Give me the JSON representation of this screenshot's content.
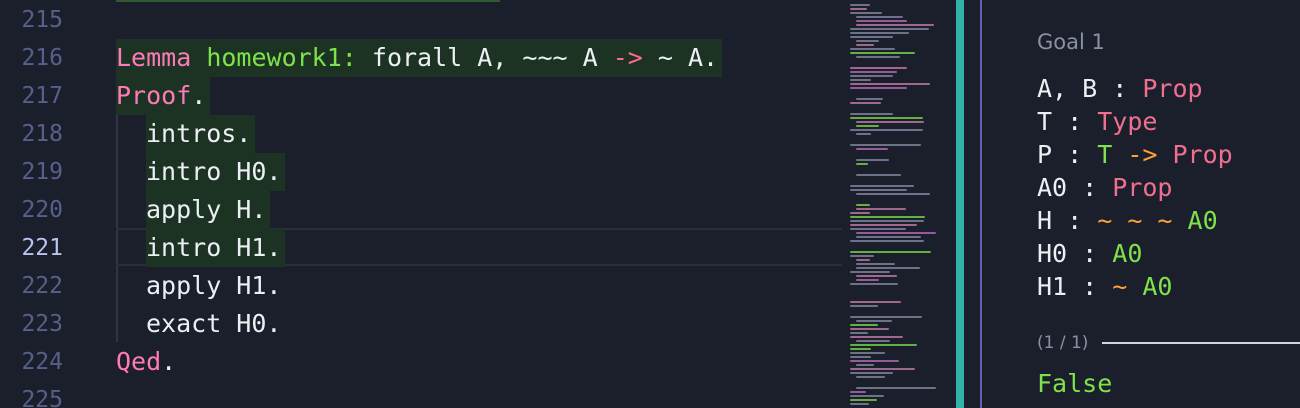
{
  "colors": {
    "background": "#1b1e2b",
    "keyword_pink": "#ff7ab7",
    "identifier_green": "#7ee24a",
    "arrow": "#ff6b8a",
    "highlight_bg": "#1c3324",
    "scrollbar_accent": "#2fb5a6",
    "panel_border": "#6d57b7",
    "tilde_orange": "#ffa13b",
    "type_pink": "#ee6f8e"
  },
  "editor": {
    "line_numbers": [
      "215",
      "216",
      "217",
      "218",
      "219",
      "220",
      "221",
      "222",
      "223",
      "224",
      "225"
    ],
    "active_line": "221",
    "lines": {
      "l216": {
        "kw": "Lemma",
        "name": "homework1:",
        "rest1": " forall A, ~~~ A ",
        "arrow": "->",
        "rest2": " ~ A."
      },
      "l217": {
        "kw": "Proof",
        "dot": "."
      },
      "l218": "intros.",
      "l219": "intro H0.",
      "l220": "apply H.",
      "l221": "intro H1.",
      "l222": "apply H1.",
      "l223": "exact H0.",
      "l224": {
        "kw": "Qed",
        "dot": "."
      }
    }
  },
  "goal_panel": {
    "title": "Goal 1",
    "hypotheses": {
      "ab": {
        "names": "A, B",
        "colon": " : ",
        "type": "Prop"
      },
      "t": {
        "names": "T",
        "colon": " : ",
        "type": "Type"
      },
      "p": {
        "names": "P",
        "colon": " : ",
        "t": "T",
        "arrow": " -> ",
        "type": "Prop"
      },
      "a0": {
        "names": "A0",
        "colon": " : ",
        "type": "Prop"
      },
      "h": {
        "names": "H",
        "colon": " : ",
        "tildes": "~ ~ ~",
        "term": " A0"
      },
      "h0": {
        "names": "H0",
        "colon": " : ",
        "term": "A0"
      },
      "h1": {
        "names": "H1",
        "colon": " : ",
        "tildes": "~",
        "term": " A0"
      }
    },
    "count": "(1 / 1)",
    "conclusion": "False"
  }
}
